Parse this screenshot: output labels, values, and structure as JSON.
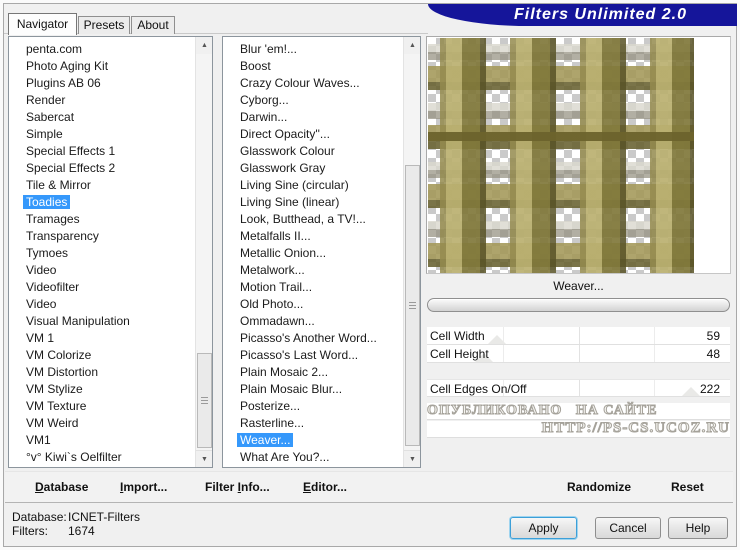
{
  "window": {
    "title": "Filters Unlimited 2.0"
  },
  "colors": {
    "title_bar": "#15159a",
    "selection": "#3598fb"
  },
  "tabs": [
    {
      "label": "Navigator",
      "active": true
    },
    {
      "label": "Presets",
      "active": false
    },
    {
      "label": "About",
      "active": false
    }
  ],
  "category_list": {
    "selected": "Toadies",
    "items": [
      "penta.com",
      "Photo Aging Kit",
      "Plugins AB 06",
      "Render",
      "Sabercat",
      "Simple",
      "Special Effects 1",
      "Special Effects 2",
      "Tile & Mirror",
      "Toadies",
      "Tramages",
      "Transparency",
      "Tymoes",
      "Video",
      "Videofilter",
      "Video",
      "Visual Manipulation",
      "VM 1",
      "VM Colorize",
      "VM Distortion",
      "VM Stylize",
      "VM Texture",
      "VM Weird",
      "VM1",
      "°v° Kiwi`s Oelfilter"
    ]
  },
  "filter_list": {
    "selected": "Weaver...",
    "items": [
      "Blur 'em!...",
      "Boost",
      "Crazy Colour Waves...",
      "Cyborg...",
      "Darwin...",
      "Direct Opacity''...",
      "Glasswork Colour",
      "Glasswork Gray",
      "Living Sine (circular)",
      "Living Sine (linear)",
      "Look, Butthead, a TV!...",
      "Metalfalls II...",
      "Metallic Onion...",
      "Metalwork...",
      "Motion Trail...",
      "Old Photo...",
      "Ommadawn...",
      "Picasso's Another Word...",
      "Picasso's Last Word...",
      "Plain Mosaic 2...",
      "Plain Mosaic Blur...",
      "Posterize...",
      "Rasterline...",
      "Weaver...",
      "What Are You?..."
    ]
  },
  "preview": {
    "filter_name_label": "Weaver..."
  },
  "parameters": [
    {
      "label": "Cell Width",
      "value": 59,
      "max": 255
    },
    {
      "label": "Cell Height",
      "value": 48,
      "max": 255
    },
    {
      "label": "Cell Edges On/Off",
      "value": 222,
      "max": 255
    }
  ],
  "watermark": {
    "line1": "ОПУБЛИКОВАНО   НА САЙТЕ",
    "line2": "HTTP://PS-CS.UCOZ.RU"
  },
  "toolbar": {
    "database": {
      "pre": "",
      "u": "D",
      "post": "atabase"
    },
    "import": {
      "pre": "",
      "u": "I",
      "post": "mport..."
    },
    "filter_info": {
      "pre": "Filter ",
      "u": "I",
      "post": "nfo..."
    },
    "editor": {
      "pre": "",
      "u": "E",
      "post": "ditor..."
    },
    "randomize": {
      "pre": "",
      "u": "",
      "post": "Randomize"
    },
    "reset": {
      "pre": "",
      "u": "",
      "post": "Reset"
    }
  },
  "status": {
    "database_label": "Database:",
    "database_value": "ICNET-Filters",
    "filters_label": "Filters:",
    "filters_value": "1674"
  },
  "footer": {
    "apply_label": "Apply",
    "cancel_label": "Cancel",
    "help_label": "Help"
  }
}
